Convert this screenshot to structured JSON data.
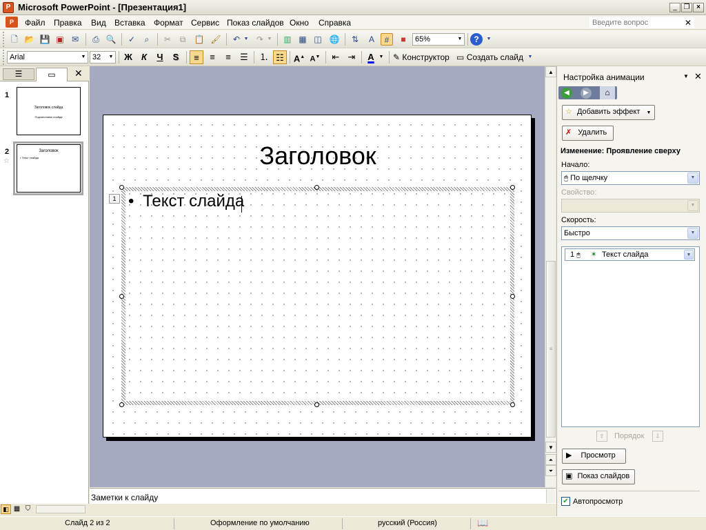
{
  "window": {
    "title": "Microsoft PowerPoint - [Презентация1]",
    "app_icon": "powerpoint-icon"
  },
  "menu": {
    "items": [
      "Файл",
      "Правка",
      "Вид",
      "Вставка",
      "Формат",
      "Сервис",
      "Показ слайдов",
      "Окно",
      "Справка"
    ],
    "help_placeholder": "Введите вопрос"
  },
  "standard_toolbar": {
    "zoom": "65%"
  },
  "formatting_toolbar": {
    "font": "Arial",
    "size": "32",
    "bold": "Ж",
    "italic": "К",
    "underline": "Ч",
    "shadow": "S",
    "designer": "Конструктор",
    "new_slide": "Создать слайд"
  },
  "slides_pane": {
    "slides": [
      {
        "number": "1",
        "title": "Заголовок слайда",
        "subtitle": "Подзаголовок слайда"
      },
      {
        "number": "2",
        "title": "Заголовок",
        "bullet": "• Текст слайда"
      }
    ]
  },
  "slide": {
    "title": "Заголовок",
    "bullet_marker": "•",
    "body_text": "Текст слайда",
    "anim_tag": "1"
  },
  "notes": {
    "placeholder": "Заметки к слайду"
  },
  "statusbar": {
    "slide": "Слайд 2 из 2",
    "design": "Оформление по умолчанию",
    "language": "русский (Россия)"
  },
  "taskpane": {
    "title": "Настройка анимации",
    "add_effect": "Добавить эффект",
    "delete": "Удалить",
    "change_label": "Изменение: Проявление сверху",
    "start_label": "Начало:",
    "start_value": "По щелчку",
    "property_label": "Свойство:",
    "speed_label": "Скорость:",
    "speed_value": "Быстро",
    "list_item_num": "1",
    "list_item_text": "Текст слайда",
    "reorder_label": "Порядок",
    "play": "Просмотр",
    "slideshow": "Показ слайдов",
    "autopreview": "Автопросмотр",
    "autopreview_checked": true
  }
}
